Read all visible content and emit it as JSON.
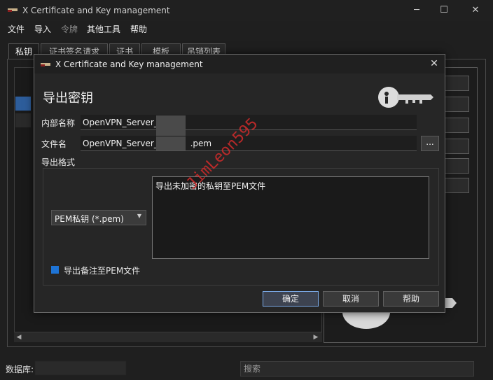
{
  "window": {
    "title": "X Certificate and Key management",
    "minimize": "─",
    "maximize": "☐",
    "close": "✕"
  },
  "menu": {
    "items": [
      {
        "label": "文件",
        "enabled": true
      },
      {
        "label": "导入",
        "enabled": true
      },
      {
        "label": "令牌",
        "enabled": false
      },
      {
        "label": "其他工具",
        "enabled": true
      },
      {
        "label": "帮助",
        "enabled": true
      }
    ]
  },
  "tabs": [
    {
      "label": "私钥",
      "active": true
    },
    {
      "label": "证书签名请求",
      "active": false
    },
    {
      "label": "证书",
      "active": false
    },
    {
      "label": "模板",
      "active": false
    },
    {
      "label": "吊销列表",
      "active": false
    }
  ],
  "statusbar": {
    "db_label": "数据库:",
    "search_placeholder": "搜索"
  },
  "dialog": {
    "title": "X Certificate and Key management",
    "close": "✕",
    "heading": "导出密钥",
    "internal_name_label": "内部名称",
    "internal_name_value": "OpenVPN_Server_",
    "filename_label": "文件名",
    "filename_value": "OpenVPN_Server_            .pem",
    "browse_label": "...",
    "format_group_label": "导出格式",
    "format_selected": "PEM私钥 (*.pem)",
    "format_description": "导出未加密的私钥至PEM文件",
    "export_comment_label": "导出备注至PEM文件",
    "export_comment_checked": true,
    "ok_label": "确定",
    "cancel_label": "取消",
    "help_label": "帮助"
  },
  "watermark": "JimLeon595",
  "colors": {
    "accent": "#1e74d6",
    "watermark": "#d32b2b",
    "background": "#1f1f1f"
  }
}
